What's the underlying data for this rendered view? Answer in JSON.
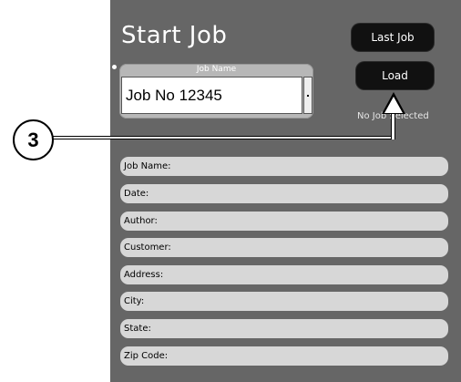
{
  "header": {
    "title": "Start Job"
  },
  "buttons": {
    "last_job": "Last Job",
    "load": "Load"
  },
  "status": {
    "text": "No Job Selected"
  },
  "job_picker": {
    "label": "Job Name",
    "value": "Job No 12345"
  },
  "callout": {
    "number": "3"
  },
  "fields": [
    {
      "label": "Job Name:"
    },
    {
      "label": "Date:"
    },
    {
      "label": "Author:"
    },
    {
      "label": "Customer:"
    },
    {
      "label": "Address:"
    },
    {
      "label": "City:"
    },
    {
      "label": "State:"
    },
    {
      "label": "Zip Code:"
    }
  ],
  "colors": {
    "panel": "#666666",
    "button": "#111111",
    "field": "#d7d7d7"
  }
}
